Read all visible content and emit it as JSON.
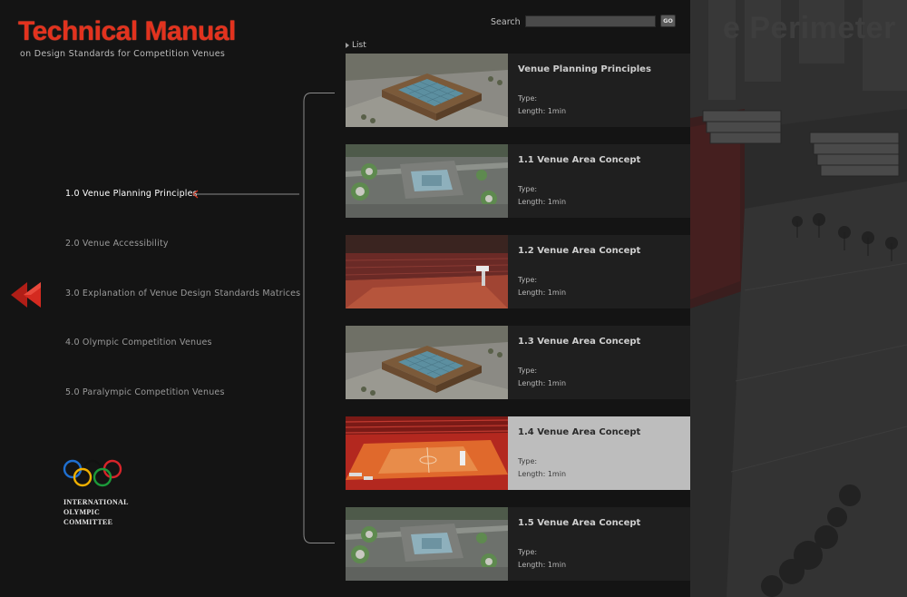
{
  "header": {
    "title": "Technical Manual",
    "subtitle": "on Design Standards for Competition Venues"
  },
  "search": {
    "label": "Search",
    "value": "",
    "placeholder": "",
    "go_label": "GO"
  },
  "nav": {
    "items": [
      {
        "label": "1.0 Venue Planning Principles",
        "active": true
      },
      {
        "label": "2.0 Venue Accessibility",
        "active": false
      },
      {
        "label": "3.0 Explanation of Venue Design Standards Matrices",
        "active": false
      },
      {
        "label": "4.0 Olympic Competition Venues",
        "active": false
      },
      {
        "label": "5.0 Paralympic Competition Venues",
        "active": false
      }
    ]
  },
  "logo": {
    "lines": [
      "INTERNATIONAL",
      "OLYMPIC",
      "COMMITTEE"
    ]
  },
  "list": {
    "label": "List",
    "items": [
      {
        "title": "Venue Planning Principles",
        "type": "Type:",
        "length": "Length: 1min",
        "thumb": "aerial-venue",
        "selected": false
      },
      {
        "title": "1.1 Venue Area Concept",
        "type": "Type:",
        "length": "Length: 1min",
        "thumb": "site-plan",
        "selected": false
      },
      {
        "title": "1.2 Venue Area Concept",
        "type": "Type:",
        "length": "Length: 1min",
        "thumb": "arena-interior",
        "selected": false
      },
      {
        "title": "1.3 Venue Area Concept",
        "type": "Type:",
        "length": "Length: 1min",
        "thumb": "aerial-venue",
        "selected": false
      },
      {
        "title": "1.4 Venue Area Concept",
        "type": "Type:",
        "length": "Length: 1min",
        "thumb": "basketball-court",
        "selected": true
      },
      {
        "title": "1.5 Venue Area Concept",
        "type": "Type:",
        "length": "Length: 1min",
        "thumb": "site-plan",
        "selected": false
      }
    ]
  },
  "backdrop": {
    "title_fragment": "e Perimeter"
  },
  "colors": {
    "title_red": "#e3321e",
    "accent_red": "#c0221a",
    "selected_card": "#bdbdbd",
    "card_bg": "#1f1f1f",
    "ring_blue": "#1f6fd0",
    "ring_yellow": "#f0b000",
    "ring_black": "#111111",
    "ring_green": "#1c9a3a",
    "ring_red": "#d8242a"
  }
}
